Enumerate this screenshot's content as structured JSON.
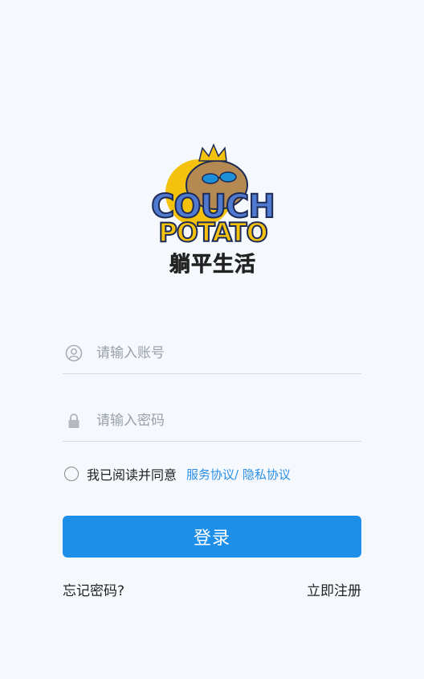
{
  "logo": {
    "line1": "COUCH",
    "line2": "POTATO",
    "line3": "躺平生活",
    "colors": {
      "blue": "#4f7ad0",
      "yellow": "#f4c20d",
      "outline": "#1d2a55"
    }
  },
  "form": {
    "account": {
      "placeholder": "请输入账号",
      "value": "",
      "icon": "user-circle-icon"
    },
    "password": {
      "placeholder": "请输入密码",
      "value": "",
      "icon": "lock-icon"
    }
  },
  "agreement": {
    "text": "我已阅读并同意",
    "service_link": "服务协议/",
    "privacy_link": "隐私协议",
    "checked": false
  },
  "login_button": {
    "label": "登录",
    "color": "#1e8fe8"
  },
  "footer": {
    "forgot_password": "忘记密码?",
    "register": "立即注册"
  }
}
